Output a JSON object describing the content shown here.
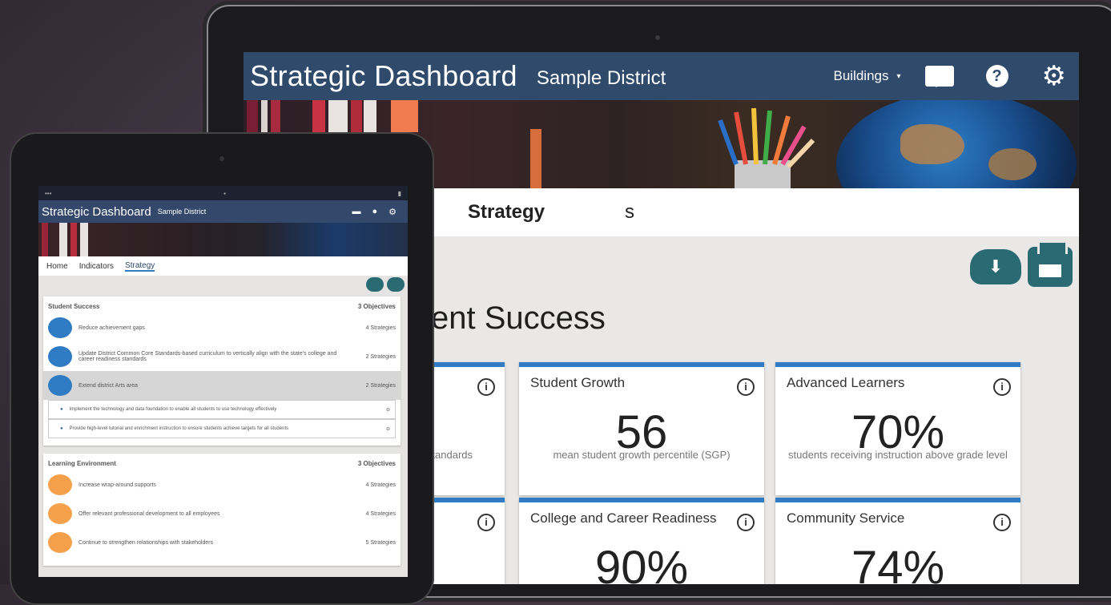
{
  "laptop": {
    "header": {
      "title": "Strategic Dashboard",
      "district": "Sample District",
      "buildings_label": "Buildings",
      "caret": "▾",
      "help_icon": "?",
      "gear_icon": "⚙"
    },
    "tab_partial": "s",
    "tab_strategy": "Strategy",
    "page_title_partial": "ent Success",
    "cards": [
      {
        "title": "",
        "value": "",
        "subtitle": "tandards"
      },
      {
        "title": "Student Growth",
        "value": "56",
        "subtitle": "mean student growth percentile (SGP)"
      },
      {
        "title": "Advanced Learners",
        "value": "70%",
        "subtitle": "students receiving instruction above grade level"
      },
      {
        "title": "",
        "value": "",
        "subtitle": ""
      },
      {
        "title": "College and Career Readiness",
        "value": "90%",
        "subtitle": ""
      },
      {
        "title": "Community Service",
        "value": "74%",
        "subtitle": ""
      }
    ],
    "info_icon": "i",
    "download_icon": "⬇",
    "accent_color": "#2f7bc4",
    "header_color": "#2f4a6b",
    "action_color": "#2a6a73"
  },
  "tablet": {
    "title": "Strategic Dashboard",
    "district": "Sample District",
    "tabs": [
      "Home",
      "Indicators",
      "Strategy"
    ],
    "sections": [
      {
        "name": "Student Success",
        "count": "3 Objectives",
        "rows": [
          {
            "text": "Reduce achievement gaps",
            "count": "4 Strategies",
            "color": "#2f7bc4"
          },
          {
            "text": "Update District Common Core Standards-based curriculum to vertically align with the state's college and career readiness standards",
            "count": "2 Strategies",
            "color": "#2f7bc4"
          },
          {
            "text": "Extend district Arts area",
            "count": "2 Strategies",
            "color": "#2f7bc4"
          }
        ],
        "subrows": [
          {
            "text": "Implement the technology and data foundation to enable all students to use technology effectively",
            "icon": "⊖"
          },
          {
            "text": "Provide high-level tutorial and enrichment instruction to ensure students achieve targets for all students",
            "icon": "⊖"
          }
        ]
      },
      {
        "name": "Learning Environment",
        "count": "3 Objectives",
        "rows": [
          {
            "text": "Increase wrap-around supports",
            "count": "4 Strategies",
            "color": "#f5a04a"
          },
          {
            "text": "Offer relevant professional development to all employees",
            "count": "4 Strategies",
            "color": "#f5a04a"
          },
          {
            "text": "Continue to strengthen relationships with stakeholders",
            "count": "5 Strategies",
            "color": "#f5a04a"
          }
        ]
      }
    ]
  }
}
